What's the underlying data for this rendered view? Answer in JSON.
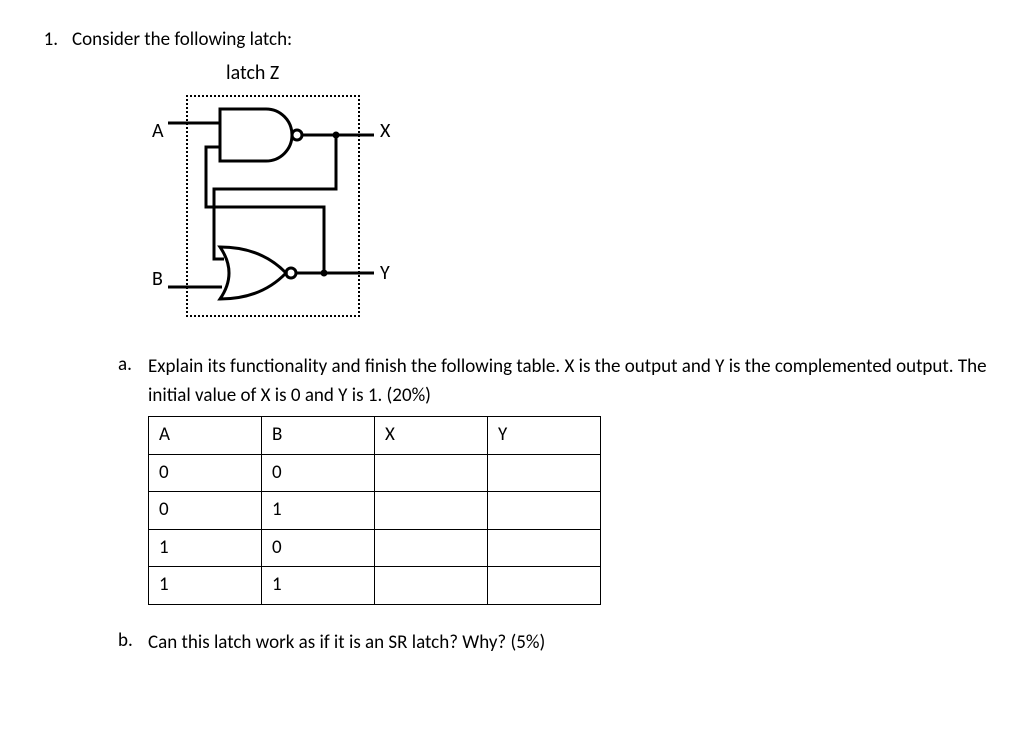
{
  "question": {
    "number": "1.",
    "prompt": "Consider the following latch:"
  },
  "circuit": {
    "title": "latch Z",
    "input_top": "A",
    "input_bottom": "B",
    "output_top": "X",
    "output_bottom": "Y"
  },
  "subparts": {
    "a": {
      "label": "a.",
      "text": "Explain its functionality and finish the following table. X is the output and Y is the complemented output. The initial value of X is 0 and Y is 1. (20%)",
      "table": {
        "headers": [
          "A",
          "B",
          "X",
          "Y"
        ],
        "rows": [
          [
            "0",
            "0",
            "",
            ""
          ],
          [
            "0",
            "1",
            "",
            ""
          ],
          [
            "1",
            "0",
            "",
            ""
          ],
          [
            "1",
            "1",
            "",
            ""
          ]
        ]
      }
    },
    "b": {
      "label": "b.",
      "text": "Can this latch work as if it is an SR latch? Why? (5%)"
    }
  }
}
